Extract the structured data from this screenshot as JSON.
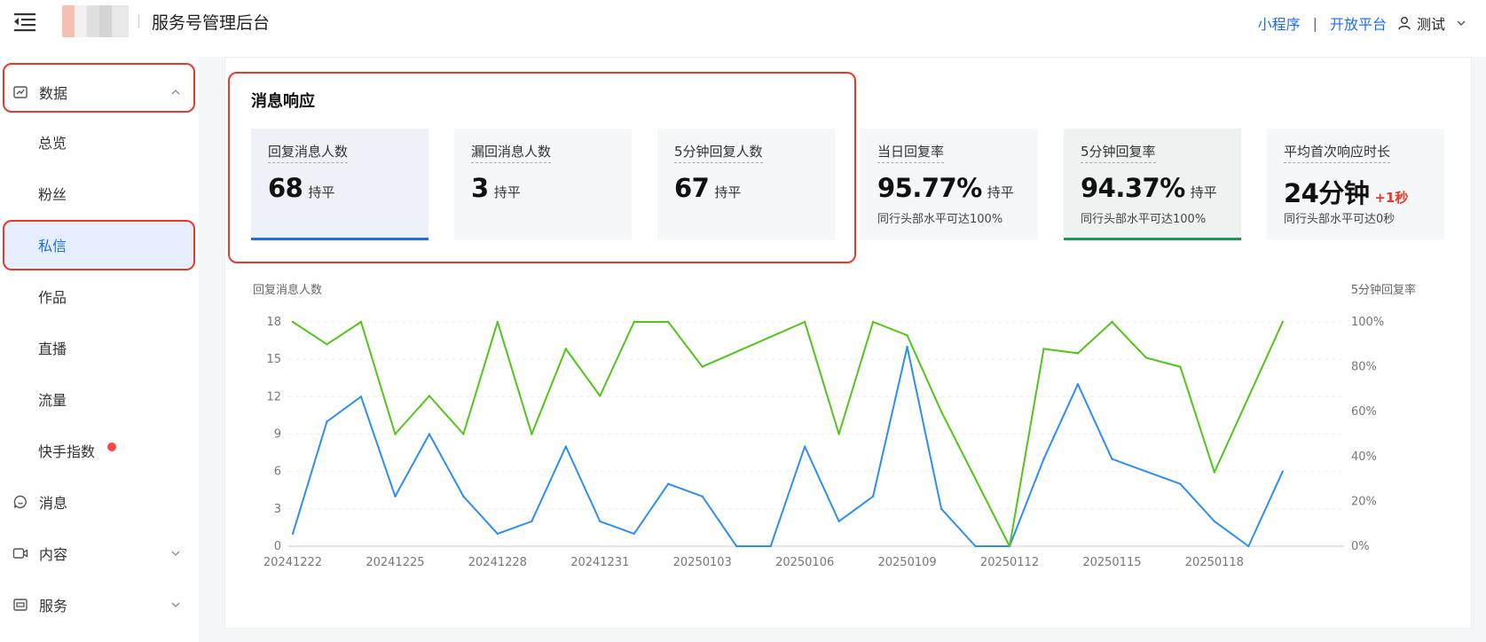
{
  "header": {
    "title": "服务号管理后台",
    "links": [
      "小程序",
      "开放平台"
    ],
    "separator": "|",
    "user_name": "测试"
  },
  "sidebar": {
    "items": [
      {
        "label": "数据",
        "icon": "chart-icon",
        "expanded": true
      },
      {
        "label": "总览"
      },
      {
        "label": "粉丝"
      },
      {
        "label": "私信",
        "active": true
      },
      {
        "label": "作品"
      },
      {
        "label": "直播"
      },
      {
        "label": "流量"
      },
      {
        "label": "快手指数",
        "badge_dot": true
      },
      {
        "label": "消息",
        "icon": "message-icon"
      },
      {
        "label": "内容",
        "icon": "video-icon"
      },
      {
        "label": "服务",
        "icon": "service-icon"
      }
    ]
  },
  "section": {
    "title": "消息响应"
  },
  "metrics": [
    {
      "label": "回复消息人数",
      "value": "68",
      "change": "持平",
      "note": ""
    },
    {
      "label": "漏回消息人数",
      "value": "3",
      "change": "持平",
      "note": ""
    },
    {
      "label": "5分钟回复人数",
      "value": "67",
      "change": "持平",
      "note": ""
    },
    {
      "label": "当日回复率",
      "value": "95.77%",
      "change": "持平",
      "note": "同行头部水平可达100%"
    },
    {
      "label": "5分钟回复率",
      "value": "94.37%",
      "change": "持平",
      "note": "同行头部水平可达100%"
    },
    {
      "label": "平均首次响应时长",
      "value": "24分钟",
      "change": "+1秒",
      "note": "同行头部水平可达0秒"
    }
  ],
  "colors": {
    "accent": "#1d6ff2",
    "left_series": "#2f8fee",
    "right_series": "#52c41a",
    "highlight_box": "#e8392b"
  },
  "chart_data": {
    "type": "line",
    "ylabel_left": "回复消息人数",
    "ylabel_right": "5分钟回复率",
    "x": [
      "20241222",
      "20241223",
      "20241224",
      "20241225",
      "20241226",
      "20241227",
      "20241228",
      "20241229",
      "20241230",
      "20241231",
      "20250101",
      "20250102",
      "20250103",
      "20250104",
      "20250105",
      "20250106",
      "20250107",
      "20250108",
      "20250109",
      "20250110",
      "20250111",
      "20250112",
      "20250113",
      "20250114",
      "20250115",
      "20250116",
      "20250117",
      "20250118",
      "20250119",
      "20250120",
      "20250121"
    ],
    "x_tick_labels": [
      "20241222",
      "20241225",
      "20241228",
      "20241231",
      "20250103",
      "20250106",
      "20250109",
      "20250112",
      "20250115",
      "20250118"
    ],
    "y_left_ticks": [
      0,
      3,
      6,
      9,
      12,
      15,
      18
    ],
    "y_left_lim": [
      0,
      18
    ],
    "y_right_ticks": [
      "0%",
      "20%",
      "40%",
      "60%",
      "80%",
      "100%"
    ],
    "y_right_lim": [
      0,
      100
    ],
    "grid": true,
    "series": [
      {
        "name": "回复消息人数",
        "axis": "left",
        "values": [
          1,
          10,
          12,
          4,
          9,
          4,
          1,
          2,
          8,
          2,
          1,
          5,
          4,
          0,
          0,
          8,
          2,
          4,
          16,
          3,
          0,
          0,
          7,
          13,
          7,
          6,
          5,
          2,
          0,
          6
        ]
      },
      {
        "name": "5分钟回复率",
        "axis": "right",
        "values": [
          100,
          90,
          100,
          50,
          67,
          50,
          100,
          50,
          88,
          67,
          100,
          100,
          80,
          null,
          null,
          100,
          50,
          100,
          94,
          60,
          null,
          0,
          88,
          86,
          100,
          84,
          80,
          33,
          null,
          100
        ]
      }
    ]
  }
}
